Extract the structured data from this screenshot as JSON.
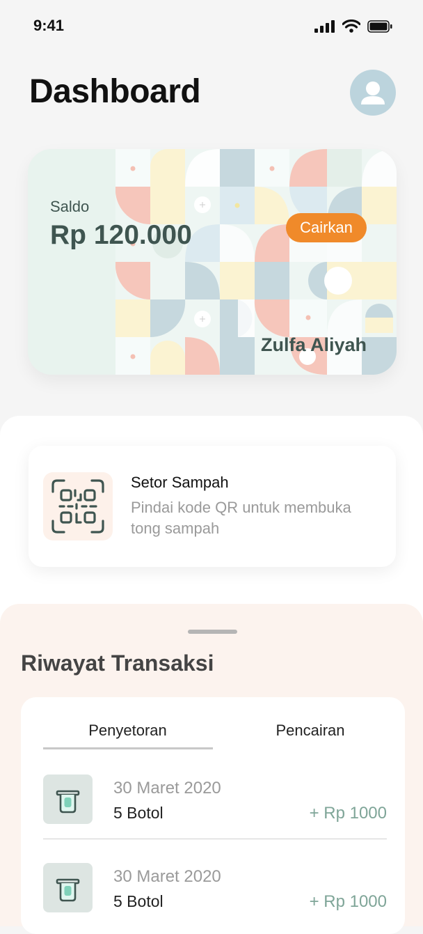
{
  "status_bar": {
    "time": "9:41"
  },
  "header": {
    "title": "Dashboard"
  },
  "balance_card": {
    "label": "Saldo",
    "balance": "Rp 120.000",
    "withdraw_button": "Cairkan",
    "owner_name": "Zulfa Aliyah"
  },
  "setor_sampah": {
    "title": "Setor Sampah",
    "description": "Pindai kode QR untuk membuka tong sampah"
  },
  "history": {
    "title": "Riwayat Transaksi",
    "tabs": [
      "Penyetoran",
      "Pencairan"
    ],
    "active_tab": "Penyetoran",
    "transactions": [
      {
        "date": "30 Maret 2020",
        "quantity": "5 Botol",
        "amount": "+ Rp 1000"
      },
      {
        "date": "30 Maret 2020",
        "quantity": "5 Botol",
        "amount": "+ Rp 1000"
      }
    ]
  },
  "colors": {
    "accent_orange": "#f08a2a",
    "card_text": "#3f5550",
    "amount_green": "#7fa598",
    "history_bg": "#fcf3ee"
  },
  "icons": [
    "signal-icon",
    "wifi-icon",
    "battery-icon",
    "user-avatar-icon",
    "qr-code-icon",
    "trash-bin-icon"
  ]
}
